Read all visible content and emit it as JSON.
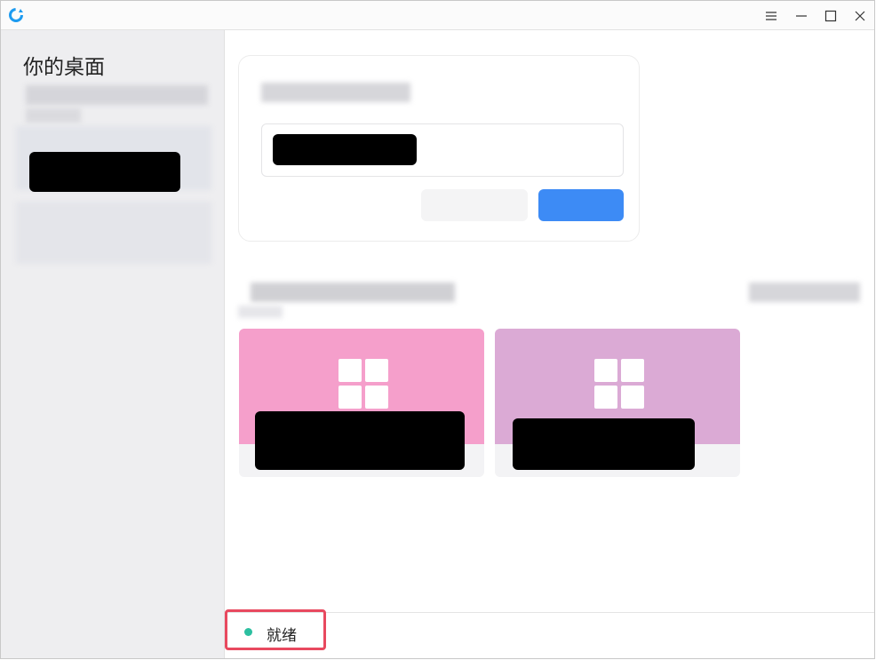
{
  "titlebar": {
    "logo_icon": "refresh-logo-icon",
    "controls": [
      "menu-icon",
      "minimize-icon",
      "maximize-icon",
      "close-icon"
    ]
  },
  "sidebar": {
    "title": "你的桌面"
  },
  "status": {
    "label": "就绪",
    "dot_color": "#2cbfa0"
  },
  "desktops": [
    {
      "color": "#f59fcb",
      "icon": "windows-logo-icon"
    },
    {
      "color": "#dbaad5",
      "icon": "windows-logo-icon"
    }
  ],
  "colors": {
    "accent": "#3d8bf5",
    "highlight_border": "#e8495f"
  }
}
